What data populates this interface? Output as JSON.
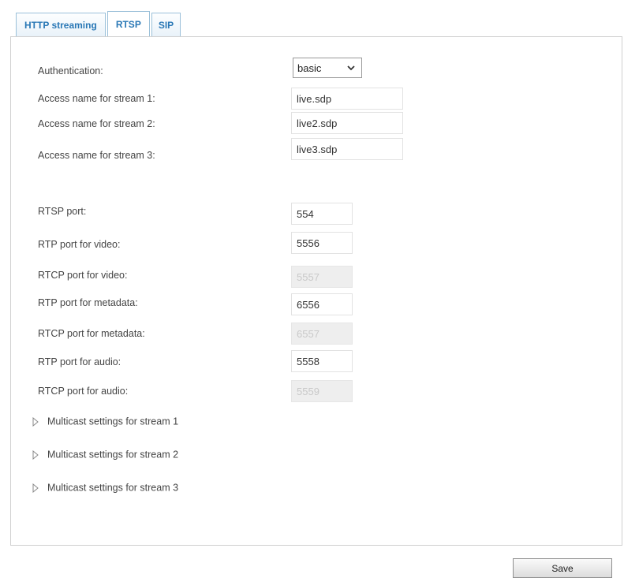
{
  "tabs": [
    {
      "label": "HTTP streaming",
      "active": false
    },
    {
      "label": "RTSP",
      "active": true
    },
    {
      "label": "SIP",
      "active": false
    }
  ],
  "authentication": {
    "label": "Authentication:",
    "value": "basic"
  },
  "streams": [
    {
      "label": "Access name for stream 1:",
      "value": "live.sdp"
    },
    {
      "label": "Access name for stream 2:",
      "value": "live2.sdp"
    },
    {
      "label": "Access name for stream 3:",
      "value": "live3.sdp"
    }
  ],
  "ports": [
    {
      "label": "RTSP port:",
      "value": "554",
      "disabled": false
    },
    {
      "label": "RTP port for video:",
      "value": "5556",
      "disabled": false
    },
    {
      "label": "RTCP port for video:",
      "value": "5557",
      "disabled": true
    },
    {
      "label": "RTP port for metadata:",
      "value": "6556",
      "disabled": false
    },
    {
      "label": "RTCP port for metadata:",
      "value": "6557",
      "disabled": true
    },
    {
      "label": "RTP port for audio:",
      "value": "5558",
      "disabled": false
    },
    {
      "label": "RTCP port for audio:",
      "value": "5559",
      "disabled": true
    }
  ],
  "multicast": [
    {
      "label": "Multicast settings for stream 1"
    },
    {
      "label": "Multicast settings for stream 2"
    },
    {
      "label": "Multicast settings for stream 3"
    }
  ],
  "save_label": "Save"
}
